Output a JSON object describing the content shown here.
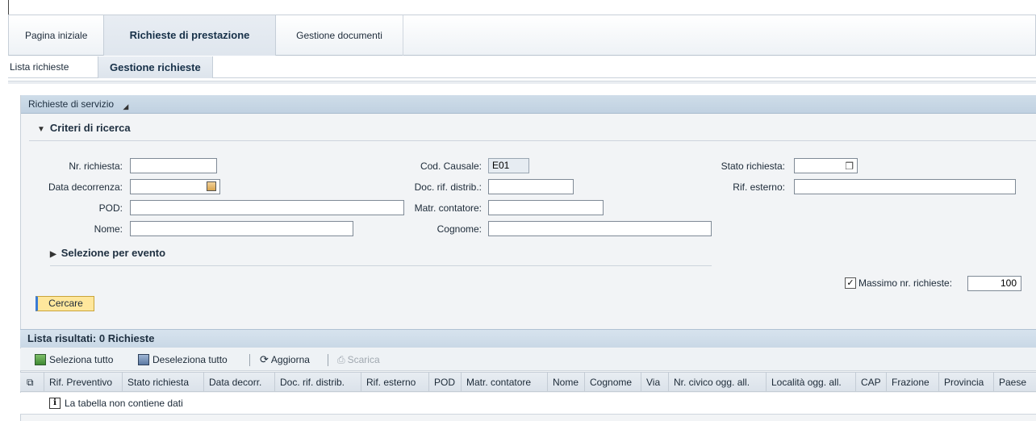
{
  "top_tabs": [
    {
      "label": "Pagina iniziale"
    },
    {
      "label": "Richieste di prestazione"
    },
    {
      "label": "Gestione documenti"
    }
  ],
  "sub_tabs": [
    {
      "label": "Lista richieste"
    },
    {
      "label": "Gestione richieste"
    }
  ],
  "panel": {
    "title": "Richieste di servizio",
    "criteria_title": "Criteri di ricerca",
    "event_selection_title": "Selezione per evento"
  },
  "form": {
    "nr_richiesta": {
      "label": "Nr. richiesta:",
      "value": ""
    },
    "data_decorrenza": {
      "label": "Data decorrenza:",
      "value": ""
    },
    "pod": {
      "label": "POD:",
      "value": ""
    },
    "nome": {
      "label": "Nome:",
      "value": ""
    },
    "cod_causale": {
      "label": "Cod. Causale:",
      "value": "E01"
    },
    "doc_rif_distrib": {
      "label": "Doc. rif. distrib.:",
      "value": ""
    },
    "matr_contatore": {
      "label": "Matr. contatore:",
      "value": ""
    },
    "cognome": {
      "label": "Cognome:",
      "value": ""
    },
    "stato_richiesta": {
      "label": "Stato richiesta:",
      "value": ""
    },
    "rif_esterno": {
      "label": "Rif. esterno:",
      "value": ""
    },
    "massimo": {
      "label": "Massimo nr. richieste:",
      "value": "100",
      "checked": true
    }
  },
  "search_button": "Cercare",
  "results": {
    "title": "Lista risultati: 0 Richieste",
    "toolbar": {
      "select_all": "Seleziona tutto",
      "deselect_all": "Deseleziona tutto",
      "refresh": "Aggiorna",
      "download": "Scarica"
    },
    "columns": [
      "Rif. Preventivo",
      "Stato richiesta",
      "Data decorr.",
      "Doc. rif. distrib.",
      "Rif. esterno",
      "POD",
      "Matr. contatore",
      "Nome",
      "Cognome",
      "Via",
      "Nr. civico ogg. all.",
      "Località ogg. all.",
      "CAP",
      "Frazione",
      "Provincia",
      "Paese"
    ],
    "empty_message": "La tabella non contiene dati"
  },
  "icons": {
    "select_all": "select-all-icon",
    "deselect_all": "deselect-all-icon",
    "refresh": "refresh-icon",
    "download": "download-icon",
    "info": "info-icon",
    "calendar": "calendar-icon",
    "value_help": "value-help-icon"
  }
}
